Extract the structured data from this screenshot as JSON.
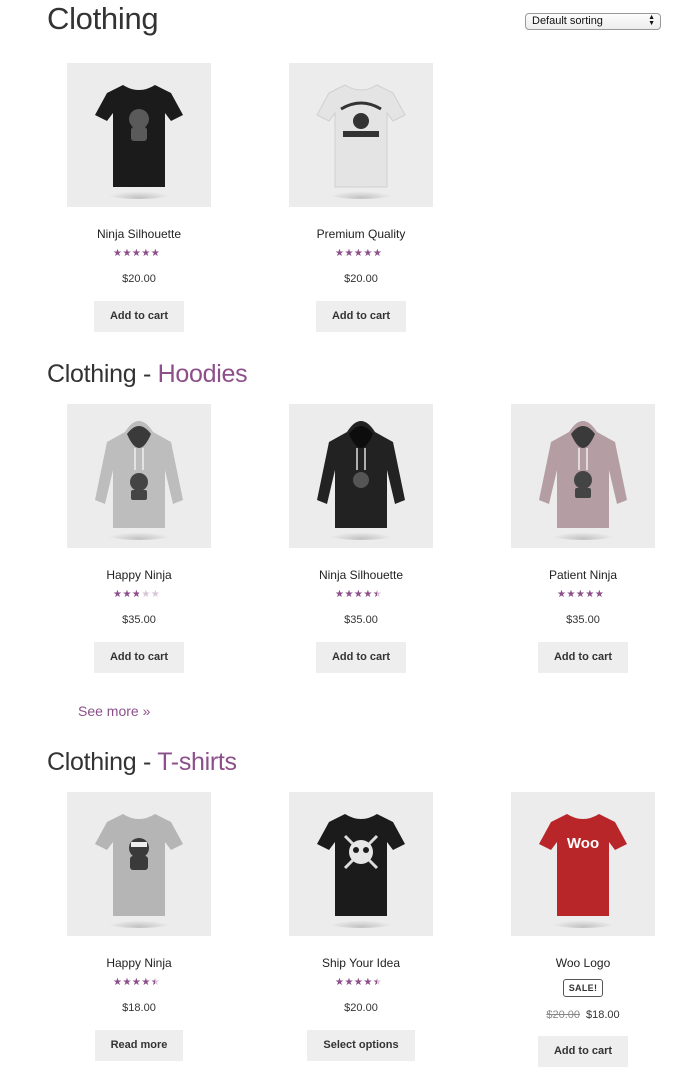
{
  "page": {
    "title": "Clothing"
  },
  "sort": {
    "selected": "Default sorting"
  },
  "top_products": [
    {
      "name": "Ninja Silhouette",
      "rating": 5.0,
      "price": "$20.00",
      "button": "Add to cart"
    },
    {
      "name": "Premium Quality",
      "rating": 4.5,
      "price": "$20.00",
      "button": "Add to cart"
    }
  ],
  "hoodies": {
    "prefix": "Clothing - ",
    "title": "Hoodies",
    "products": [
      {
        "name": "Happy Ninja",
        "rating": 2.5,
        "price": "$35.00",
        "button": "Add to cart"
      },
      {
        "name": "Ninja Silhouette",
        "rating": 4.0,
        "price": "$35.00",
        "button": "Add to cart"
      },
      {
        "name": "Patient Ninja",
        "rating": 4.7,
        "price": "$35.00",
        "button": "Add to cart"
      }
    ],
    "see_more": "See more »"
  },
  "tshirts": {
    "prefix": "Clothing - ",
    "title": "T-shirts",
    "products": [
      {
        "name": "Happy Ninja",
        "rating": 4.0,
        "price": "$18.00",
        "button": "Read more"
      },
      {
        "name": "Ship Your Idea",
        "rating": 4.0,
        "price": "$20.00",
        "button": "Select options"
      },
      {
        "name": "Woo Logo",
        "sale_badge": "SALE!",
        "old_price": "$20.00",
        "price": "$18.00",
        "button": "Add to cart"
      }
    ]
  },
  "images": {
    "woo_logo_text": "Woo"
  },
  "colors": {
    "accent": "#8c4f8a",
    "star_empty": "#d8c6d7",
    "button_bg": "#eeeeee",
    "thumb_bg": "#ececec"
  }
}
